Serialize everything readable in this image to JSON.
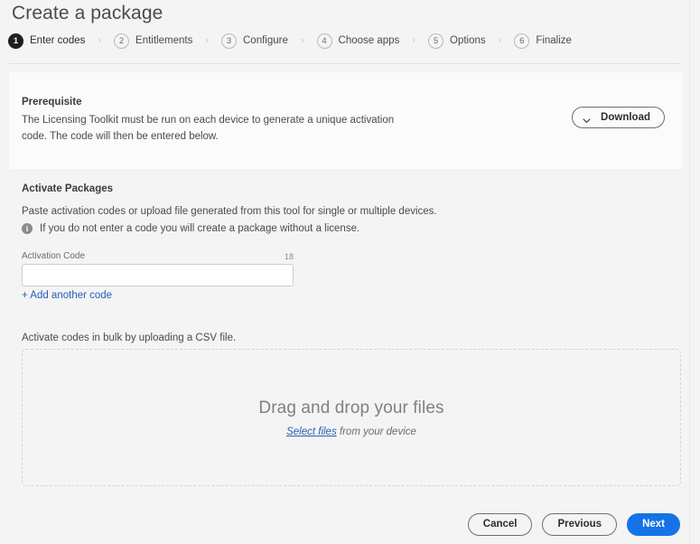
{
  "page": {
    "title": "Create a package"
  },
  "stepper": {
    "separator": "›",
    "steps": [
      {
        "number": "1",
        "label": "Enter codes",
        "active": true
      },
      {
        "number": "2",
        "label": "Entitlements",
        "active": false
      },
      {
        "number": "3",
        "label": "Configure",
        "active": false
      },
      {
        "number": "4",
        "label": "Choose apps",
        "active": false
      },
      {
        "number": "5",
        "label": "Options",
        "active": false
      },
      {
        "number": "6",
        "label": "Finalize",
        "active": false
      }
    ]
  },
  "prerequisite": {
    "title": "Prerequisite",
    "body": "The Licensing Toolkit must be run on each device to generate a unique activation code. The code will then be entered below.",
    "download_label": "Download",
    "download_icon": "chevron-down-icon"
  },
  "activate": {
    "title": "Activate Packages",
    "description": "Paste activation codes or upload file generated from this tool for single or multiple devices.",
    "note_icon": "info-icon",
    "note_text": "If you do not enter a code you will create a package without a license.",
    "field_label": "Activation Code",
    "field_count": "18",
    "field_value": "",
    "field_placeholder": "",
    "add_another_label": "+ Add another code",
    "bulk_text": "Activate codes in bulk by uploading a CSV file."
  },
  "dropzone": {
    "title": "Drag and drop your files",
    "link_label": "Select files",
    "sub_suffix": " from your device"
  },
  "footer": {
    "cancel_label": "Cancel",
    "previous_label": "Previous",
    "next_label": "Next"
  },
  "colors": {
    "accent_blue": "#1473e6",
    "link_blue": "#2a5db0",
    "active_step": "#1f1f1f",
    "page_bg": "#f4f4f4",
    "card_bg": "#fbfbfb"
  }
}
